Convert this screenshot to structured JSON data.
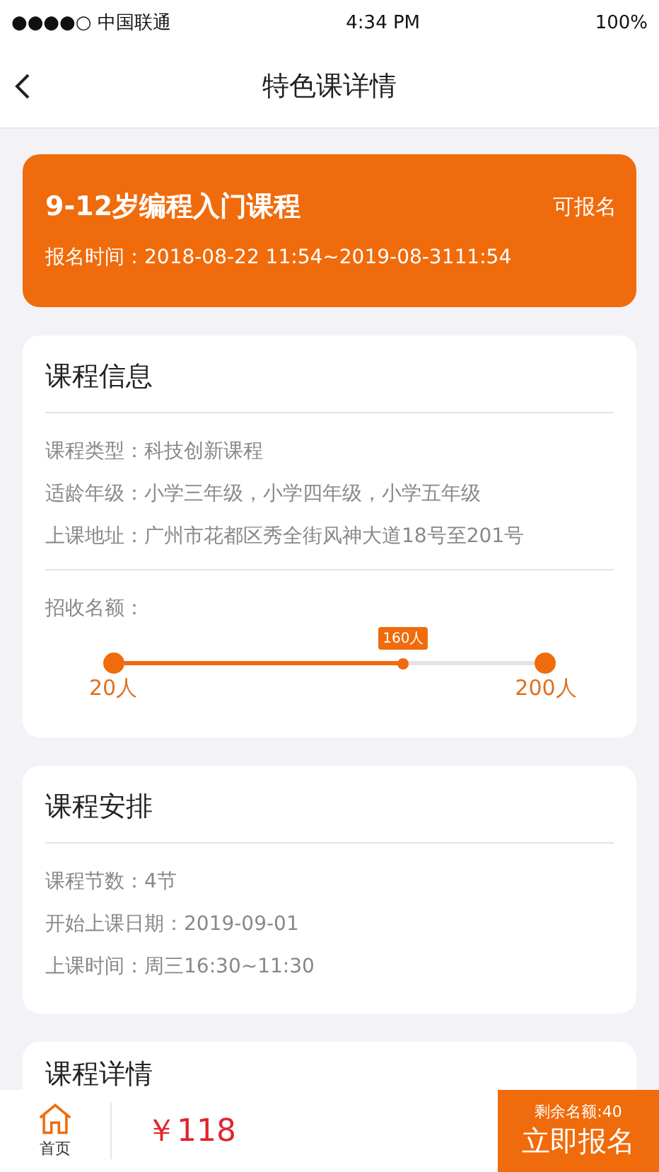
{
  "status_bar": {
    "carrier": "●●●●○ 中国联通",
    "time": "4:34 PM",
    "battery": "100%"
  },
  "nav": {
    "title": "特色课详情"
  },
  "course": {
    "title": "9-12岁编程入门课程",
    "status": "可报名",
    "signup_time": "报名时间：2018-08-22 11:54~2019-08-3111:54"
  },
  "info": {
    "heading": "课程信息",
    "rows": [
      "课程类型：科技创新课程",
      "适龄年级：小学三年级，小学四年级，小学五年级",
      "上课地址：广州市花都区秀全街风神大道18号至201号"
    ],
    "quota": {
      "label": "招收名额：",
      "min": "20人",
      "max": "200人",
      "current": "160人",
      "level": 0.68
    }
  },
  "schedule": {
    "heading": "课程安排",
    "rows": [
      "课程节数：4节",
      "开始上课日期：2019-09-01",
      "上课时间：周三16:30~11:30"
    ]
  },
  "details": {
    "heading": "课程详情"
  },
  "bottom_bar": {
    "home_label": "首页",
    "price": "￥118",
    "remaining": "剩余名额:40",
    "signup_button": "立即报名"
  }
}
